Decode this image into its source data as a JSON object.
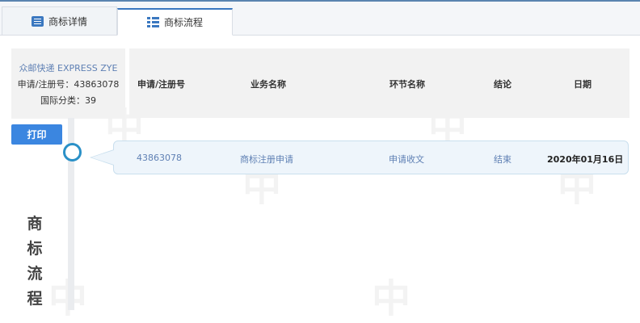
{
  "tabs": [
    {
      "label": "商标详情",
      "icon": "detail-icon"
    },
    {
      "label": "商标流程",
      "icon": "flow-icon"
    }
  ],
  "trademark": {
    "name": "众邮快递 EXPRESS ZYE",
    "reg_line": "申请/注册号：43863078",
    "class_line": "国际分类：39"
  },
  "table": {
    "headers": [
      "申请/注册号",
      "业务名称",
      "环节名称",
      "结论",
      "日期"
    ],
    "rows": [
      [
        "43863078",
        "商标注册申请",
        "申请收文",
        "结束",
        "2020年01月16日"
      ]
    ]
  },
  "print_label": "打印",
  "side_title": [
    "商",
    "标",
    "流",
    "程"
  ],
  "watermark_char": "中",
  "colors": {
    "accent": "#3b86e0",
    "link": "#5f80b4",
    "node": "#2a90c7"
  }
}
